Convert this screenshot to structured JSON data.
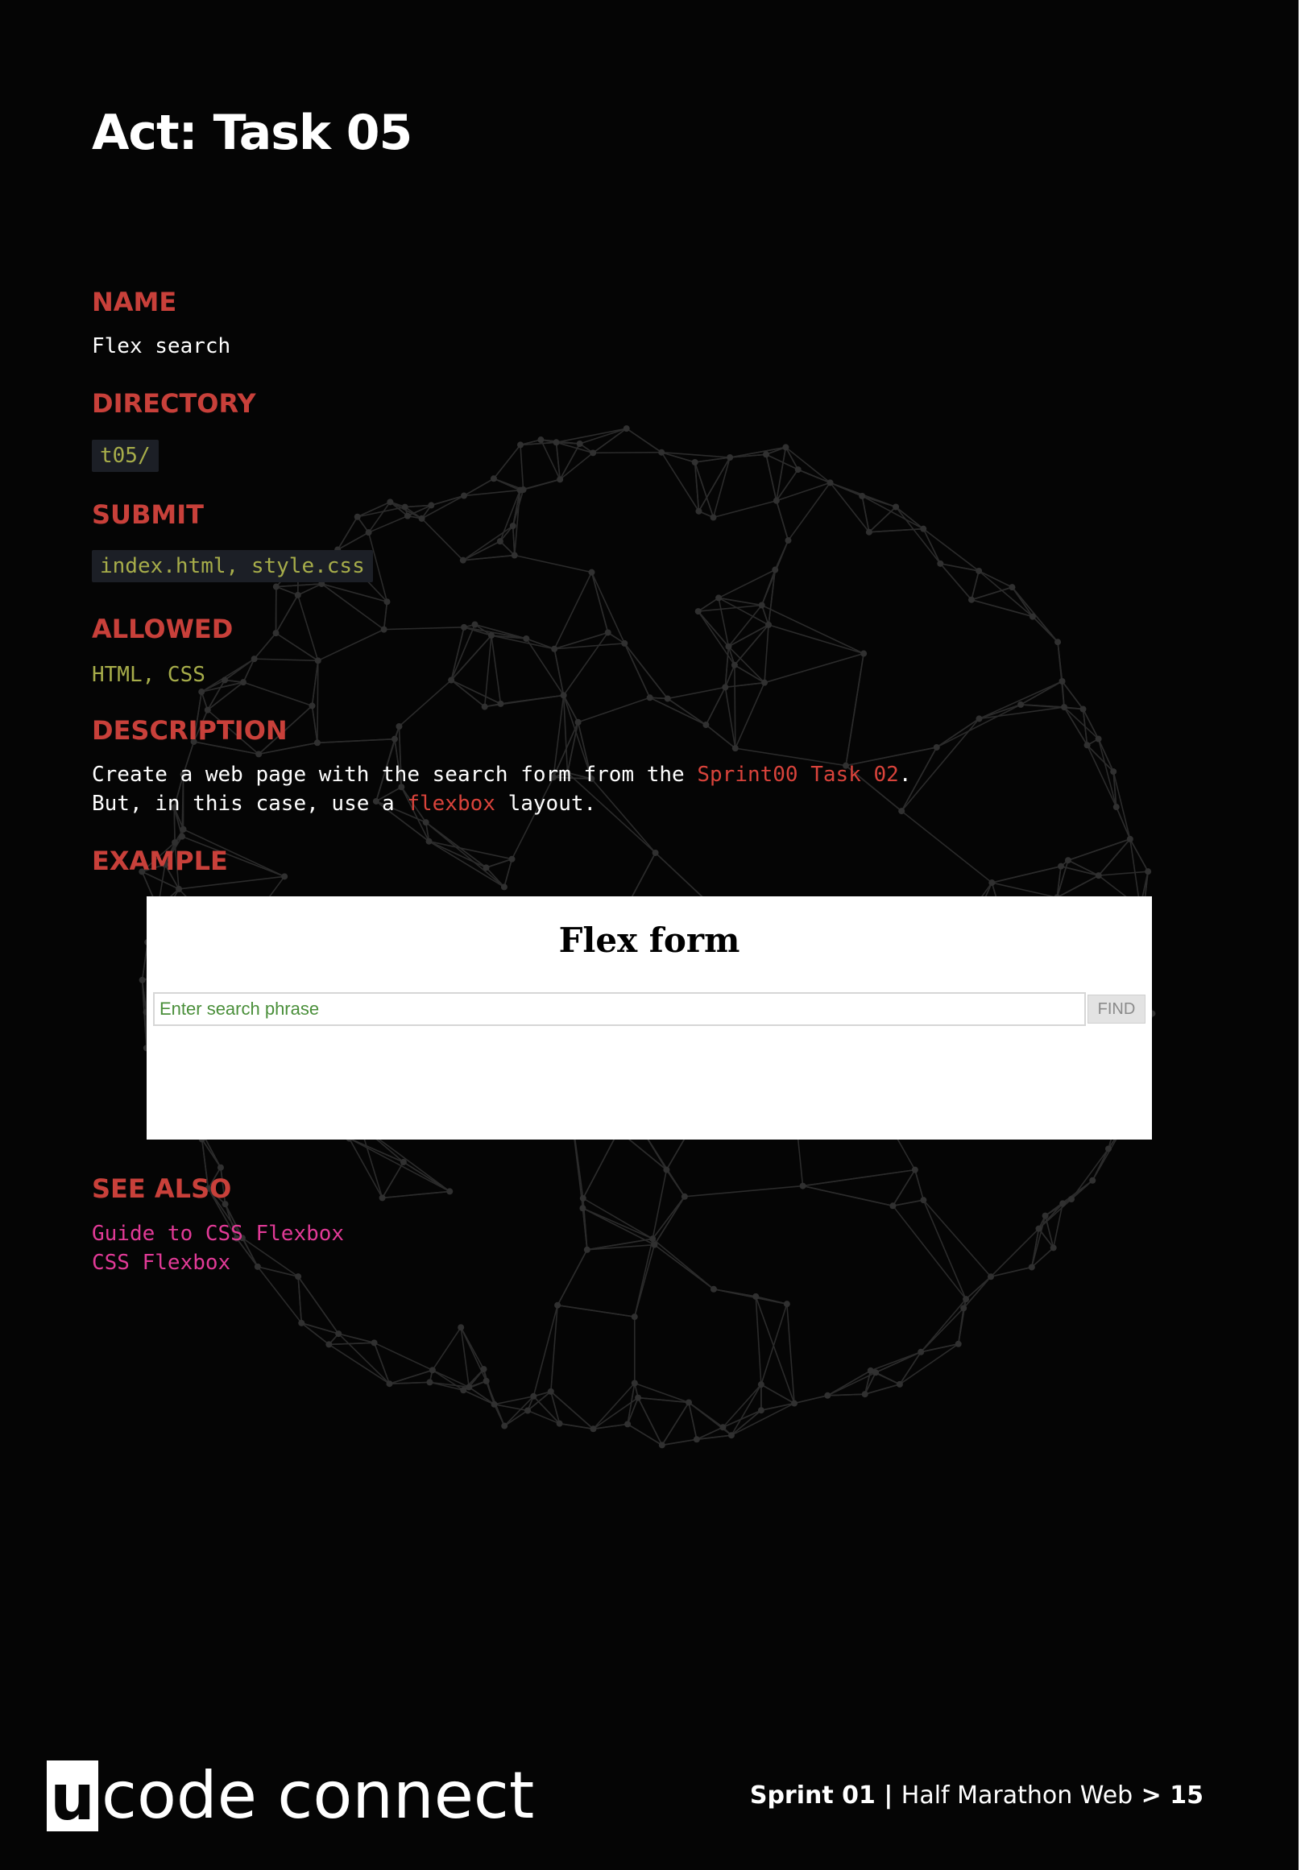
{
  "title": "Act: Task 05",
  "sections": {
    "name_label": "NAME",
    "name_value": "Flex search",
    "directory_label": "DIRECTORY",
    "directory_value": "t05/",
    "submit_label": "SUBMIT",
    "submit_value": "index.html, style.css",
    "allowed_label": "ALLOWED",
    "allowed_value": "HTML, CSS",
    "description_label": "DESCRIPTION",
    "description": {
      "line1_before": "Create a web page with the search form from the ",
      "line1_link": "Sprint00 Task 02",
      "line1_after": ".",
      "line2_before": "But, in this case, use a ",
      "line2_link": "flexbox",
      "line2_after": " layout."
    },
    "example_label": "EXAMPLE",
    "see_also_label": "SEE ALSO",
    "see_also_links": [
      "Guide to CSS Flexbox",
      "CSS Flexbox"
    ]
  },
  "example": {
    "heading": "Flex form",
    "search_placeholder": "Enter search phrase",
    "find_label": "FIND"
  },
  "footer": {
    "logo_letter": "u",
    "logo_text": "code connect",
    "sprint": "Sprint 01",
    "separator": " | ",
    "course": "Half Marathon Web",
    "arrow": " > ",
    "page": "15"
  },
  "colors": {
    "background": "#050505",
    "label_red": "#c8403a",
    "code_olive": "#a7ad4a",
    "link_pink": "#e23a97"
  }
}
